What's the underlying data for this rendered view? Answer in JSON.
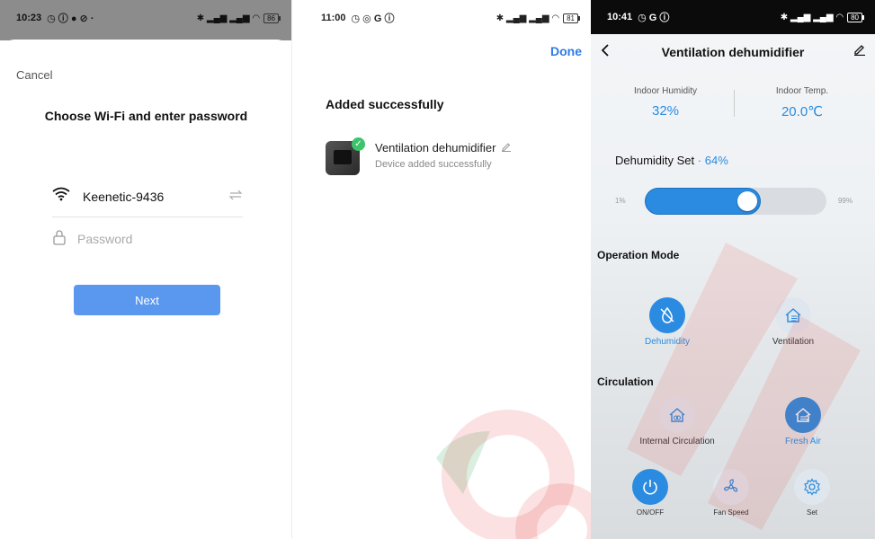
{
  "panel1": {
    "status": {
      "time": "10:23",
      "battery": "86"
    },
    "cancel_label": "Cancel",
    "title": "Choose Wi-Fi and enter password",
    "ssid": "Keenetic-9436",
    "password_placeholder": "Password",
    "next_label": "Next"
  },
  "panel2": {
    "status": {
      "time": "11:00",
      "battery": "81"
    },
    "done_label": "Done",
    "title": "Added successfully",
    "device_name": "Ventilation dehumidifier",
    "device_status": "Device added successfully"
  },
  "panel3": {
    "status": {
      "time": "10:41",
      "battery": "80"
    },
    "title": "Ventilation dehumidifier",
    "humidity_label": "Indoor Humidity",
    "humidity_value": "32%",
    "temp_label": "Indoor Temp.",
    "temp_value": "20.0℃",
    "set_label": "Dehumidity Set",
    "set_sep": "·",
    "set_value": "64%",
    "slider_min": "1%",
    "slider_max": "99%",
    "slider_level": 0.64,
    "operation_mode_heading": "Operation Mode",
    "modes": [
      "Dehumidity",
      "Ventilation"
    ],
    "circulation_heading": "Circulation",
    "circulation": [
      "Internal Circulation",
      "Fresh Air"
    ],
    "controls": [
      "ON/OFF",
      "Fan Speed",
      "Set"
    ]
  },
  "colors": {
    "accent_blue": "#2a8be0",
    "button_blue": "#5a98f0",
    "done_blue": "#2f7be6",
    "success_green": "#3cc46b"
  }
}
